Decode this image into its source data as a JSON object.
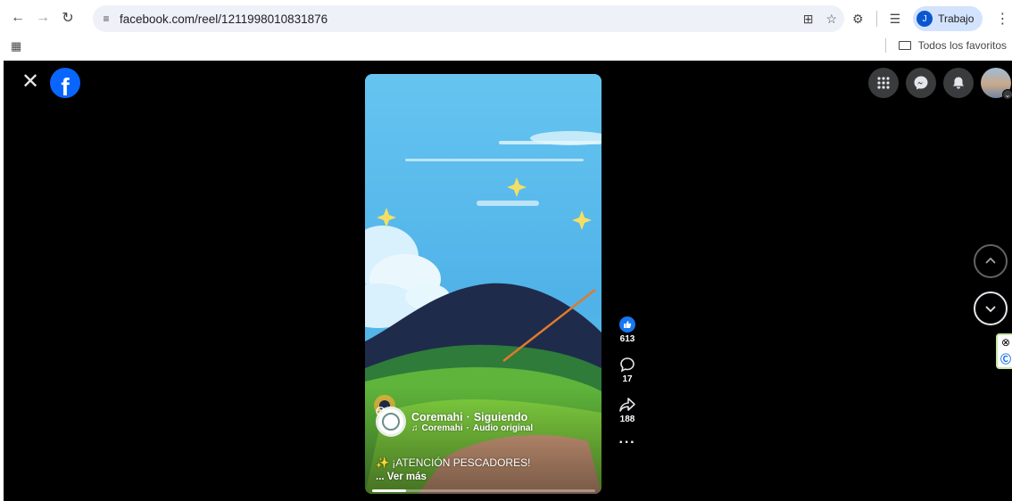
{
  "browser": {
    "url": "facebook.com/reel/1211998010831876",
    "profile_initial": "J",
    "profile_name": "Trabajo",
    "bookmarks_folder": "Todos los favoritos"
  },
  "reel": {
    "owner_name": "Coremahi",
    "follow_status": "Siguiendo",
    "separator": "·",
    "audio_owner": "Coremahi",
    "audio_label": "Audio original",
    "caption": "¡ATENCIÓN PESCADORES!",
    "see_more": "... Ver más",
    "progress": 0.15
  },
  "actions": {
    "likes": "613",
    "comments": "17",
    "shares": "188"
  },
  "colors": {
    "facebook_blue": "#0866ff",
    "like_blue": "#1877f2",
    "page_background": "#000000"
  }
}
